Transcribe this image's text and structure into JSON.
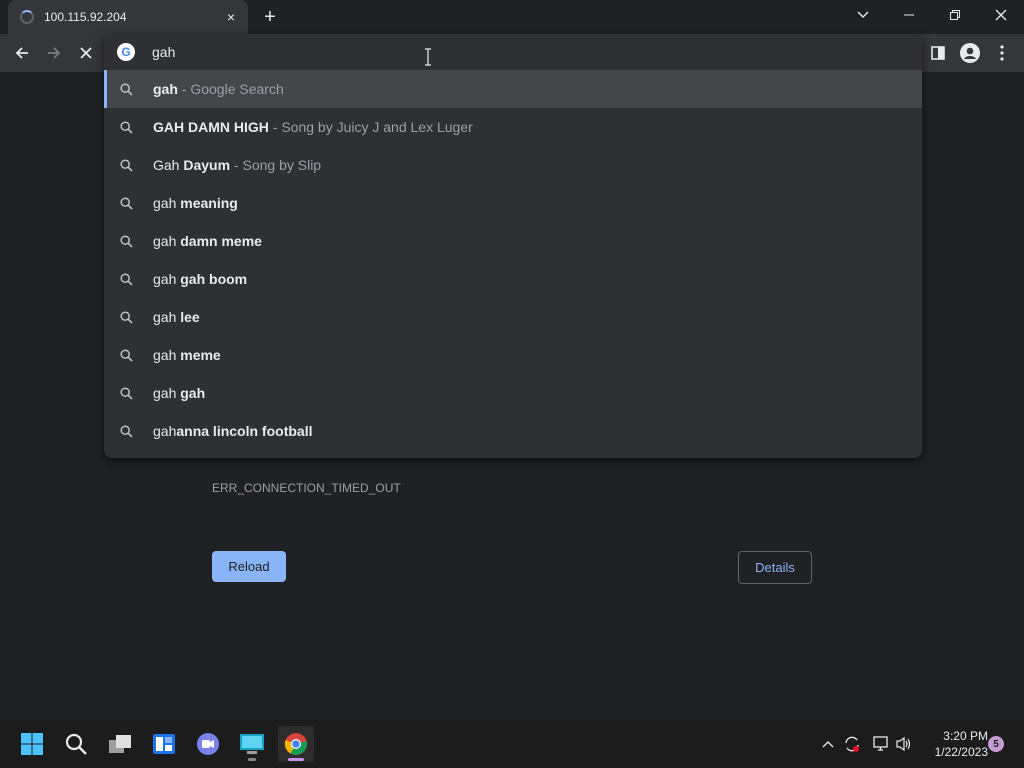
{
  "tab": {
    "title": "100.115.92.204",
    "close_label": "×"
  },
  "newtab_label": "+",
  "omnibox": {
    "value": "gah"
  },
  "suggestions": [
    {
      "prefix": "gah",
      "bold": "",
      "desc": " - Google Search",
      "selected": true
    },
    {
      "prefix": "",
      "bold": "GAH DAMN HIGH",
      "desc": " - Song by Juicy J and Lex Luger"
    },
    {
      "prefix": "Gah ",
      "bold": "Dayum",
      "desc": " - Song by Slip"
    },
    {
      "prefix": "gah ",
      "bold": "meaning",
      "desc": ""
    },
    {
      "prefix": "gah ",
      "bold": "damn meme",
      "desc": ""
    },
    {
      "prefix": "gah ",
      "bold": "gah boom",
      "desc": ""
    },
    {
      "prefix": "gah ",
      "bold": "lee",
      "desc": ""
    },
    {
      "prefix": "gah ",
      "bold": "meme",
      "desc": ""
    },
    {
      "prefix": "gah ",
      "bold": "gah",
      "desc": ""
    },
    {
      "prefix": "gah",
      "bold": "anna lincoln football",
      "desc": ""
    }
  ],
  "error": {
    "code": "ERR_CONNECTION_TIMED_OUT",
    "reload_label": "Reload",
    "details_label": "Details"
  },
  "taskbar": {
    "clock_time": "3:20 PM",
    "clock_date": "1/22/2023",
    "notification_count": "5"
  },
  "colors": {
    "accent": "#8ab4f8",
    "background": "#202124",
    "toolbar": "#35363a"
  }
}
